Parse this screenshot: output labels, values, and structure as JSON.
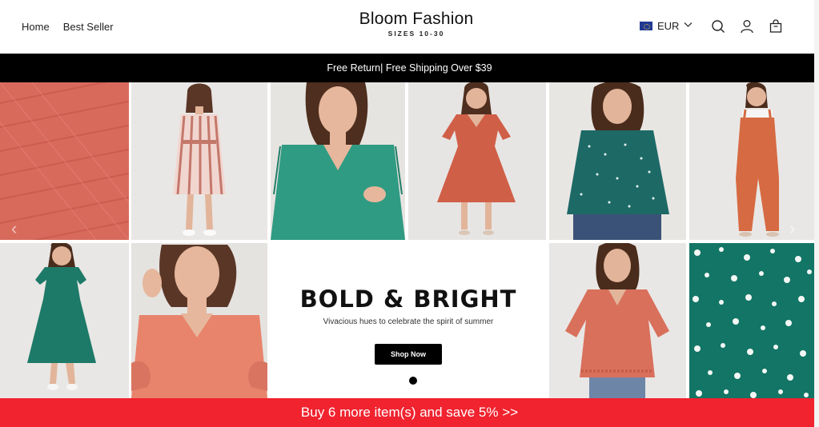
{
  "nav": {
    "home": "Home",
    "best_seller": "Best Seller"
  },
  "brand": {
    "name": "Bloom Fashion",
    "tagline": "SIZES 10-30"
  },
  "currency": {
    "code": "EUR"
  },
  "icons": {
    "search": "search-icon",
    "account": "user-icon",
    "cart": "shopping-bag-icon"
  },
  "promo_banner": "Free Return| Free Shipping Over $39",
  "hero": {
    "headline": "BOLD & BRIGHT",
    "subline": "Vivacious hues to celebrate the spirit of summer",
    "cta": "Shop Now"
  },
  "savebar": "Buy 6 more item(s) and save 5%  >>",
  "colors": {
    "accent_red": "#f0232f",
    "coral": "#d9604a",
    "teal": "#1f7a70",
    "black": "#000000"
  }
}
